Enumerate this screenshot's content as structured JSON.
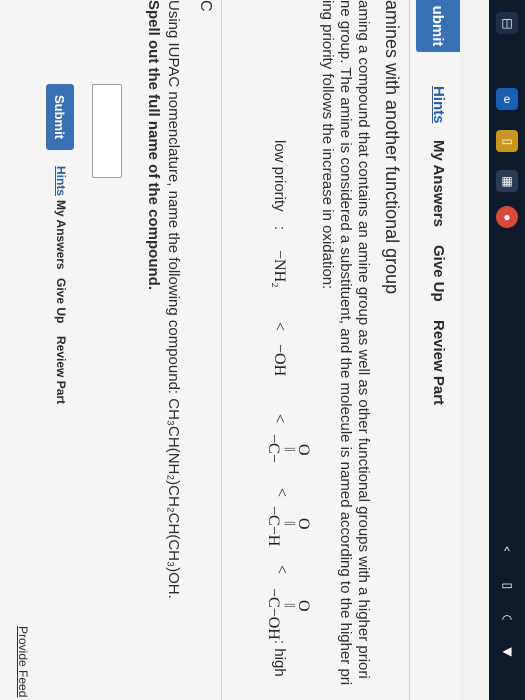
{
  "toolbar": {
    "submit_partial": "ubmit",
    "hints": "Hints",
    "my_answers": "My Answers",
    "give_up": "Give Up",
    "review_part": "Review Part"
  },
  "section": {
    "title": "amines with another functional group",
    "para_1": "aming a compound that contains an amine group as well as other functional groups with a higher priori",
    "para_2": "ne group. The amine is considered a substituent, and the molecule is named according to the higher pri",
    "para_3": "ing priority follows the increase in oxidation:"
  },
  "priority": {
    "low": "low priority",
    "colon_low": ":",
    "nh2": "−NH₂",
    "lt1": "<",
    "oh": "−OH",
    "lt2": "<",
    "o1": "O",
    "bond1": "||",
    "ketone": "−C−",
    "lt3": "<",
    "o2": "O",
    "bond2": "||",
    "aldehyde": "−C−H",
    "lt4": "<",
    "o3": "O",
    "bond3": "||",
    "acid": "−C−OH",
    "high": ": high"
  },
  "part_c": {
    "label": "C",
    "question_1": "Using IUPAC nomenclature, name the following compound: CH₃CH(NH₂)CH₂CH(CH₃)OH.",
    "question_2": "Spell out the full name of the compound.",
    "answer_value": ""
  },
  "actions": {
    "submit": "Submit",
    "hints": "Hints",
    "my_answers": "My Answers",
    "give_up": "Give Up",
    "review_part": "Review Part"
  },
  "footer": {
    "provide_feedback": "Provide Feed"
  },
  "colors": {
    "primary": "#3a70b4",
    "taskbar": "#0f1a2a"
  }
}
